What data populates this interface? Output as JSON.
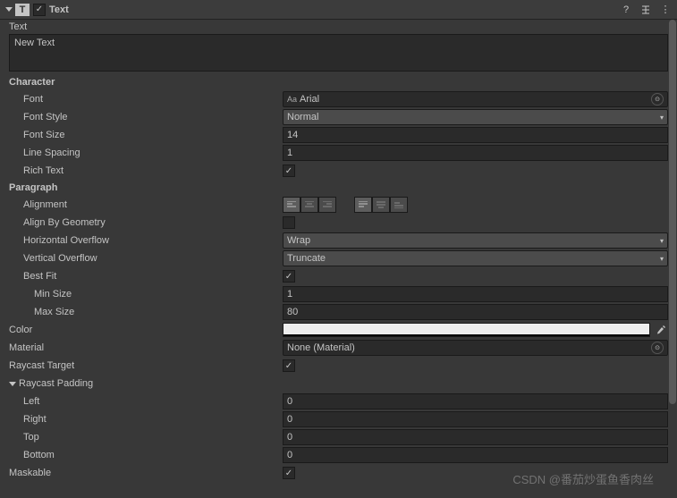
{
  "header": {
    "title": "Text"
  },
  "text": {
    "label": "Text",
    "value": "New Text"
  },
  "character": {
    "heading": "Character",
    "font_label": "Font",
    "font_value": "Arial",
    "font_prefix": "Aa",
    "fontstyle_label": "Font Style",
    "fontstyle_value": "Normal",
    "fontsize_label": "Font Size",
    "fontsize_value": "14",
    "linespacing_label": "Line Spacing",
    "linespacing_value": "1",
    "richtext_label": "Rich Text"
  },
  "paragraph": {
    "heading": "Paragraph",
    "alignment_label": "Alignment",
    "aligngeom_label": "Align By Geometry",
    "hoverflow_label": "Horizontal Overflow",
    "hoverflow_value": "Wrap",
    "voverflow_label": "Vertical Overflow",
    "voverflow_value": "Truncate",
    "bestfit_label": "Best Fit",
    "minsize_label": "Min Size",
    "minsize_value": "1",
    "maxsize_label": "Max Size",
    "maxsize_value": "80"
  },
  "color": {
    "label": "Color",
    "value": "#ffffff"
  },
  "material": {
    "label": "Material",
    "value": "None (Material)"
  },
  "raycast": {
    "label": "Raycast Target"
  },
  "padding": {
    "heading": "Raycast Padding",
    "left_label": "Left",
    "left_value": "0",
    "right_label": "Right",
    "right_value": "0",
    "top_label": "Top",
    "top_value": "0",
    "bottom_label": "Bottom",
    "bottom_value": "0"
  },
  "maskable": {
    "label": "Maskable"
  },
  "watermark": "CSDN @番茄炒蛋鱼香肉丝"
}
